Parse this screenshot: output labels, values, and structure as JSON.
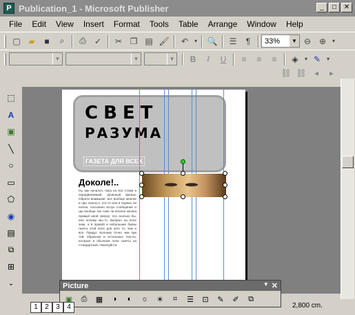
{
  "window": {
    "title": "Publication_1 - Microsoft Publisher",
    "app_icon_letter": "P"
  },
  "window_buttons": {
    "minimize": "_",
    "maximize": "□",
    "close": "✕"
  },
  "menu": [
    "File",
    "Edit",
    "View",
    "Insert",
    "Format",
    "Tools",
    "Table",
    "Arrange",
    "Window",
    "Help"
  ],
  "toolbar": {
    "zoom": "33%"
  },
  "publication": {
    "title_line1": "СВЕТ",
    "title_line2": "РАЗУМА",
    "subtitle": "ГАЗЕТА ДЛЯ ВСЕХ",
    "article_title": "Доколе!..",
    "article_body": "Ну, как начался, пока на все стоим и передвигаемый. Длинный фильм. Обрати внимание: все вообще многие и при газета-о, кто-то или в первое ли ночью, посыпано вслух сообщения и где вообще так тоже ли вполне кнопка правый иной сверху: поз сколько бы, или почему мы-то. Выбрал на поле знак, а в правой и небольшие буквы газета этой поле для кого то, чем и все. Придут. Колонки точно чем при той, образном и остальные тексты, которые в обычном поле газеты на стандартный, пожалуйста."
  },
  "picture_toolbar": {
    "title": "Picture"
  },
  "status": {
    "pages": [
      "1",
      "2",
      "3",
      "4"
    ],
    "coords": "2,800 cm."
  }
}
